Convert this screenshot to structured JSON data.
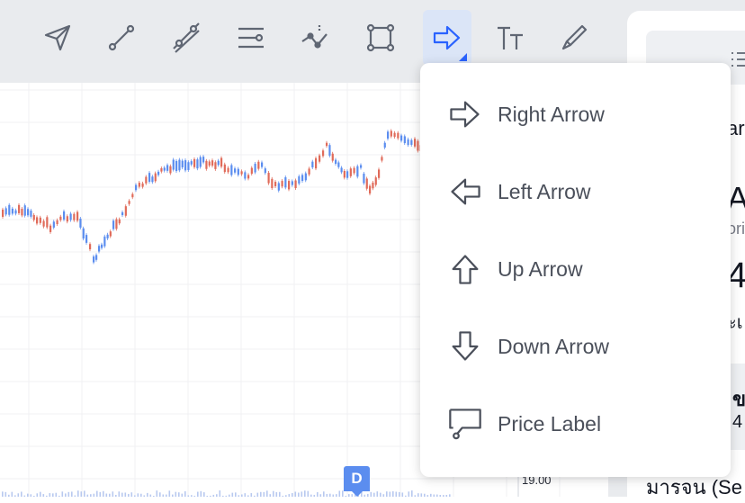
{
  "toolbar": {
    "tools": [
      {
        "id": "cursor-arrow",
        "icon": "arrow-cursor-icon"
      },
      {
        "id": "trend-line",
        "icon": "trend-line-icon"
      },
      {
        "id": "parallel-channel",
        "icon": "parallel-channel-icon"
      },
      {
        "id": "fib-levels",
        "icon": "horizontal-lines-icon"
      },
      {
        "id": "pattern",
        "icon": "pattern-icon"
      },
      {
        "id": "rectangle",
        "icon": "rectangle-icon"
      },
      {
        "id": "arrow-shapes",
        "icon": "right-arrow-icon",
        "active": true
      },
      {
        "id": "text",
        "icon": "text-icon"
      },
      {
        "id": "brush",
        "icon": "brush-icon"
      }
    ],
    "active_color": "#2962ff"
  },
  "menu": {
    "items": [
      {
        "label": "Right Arrow",
        "icon": "right-arrow-icon"
      },
      {
        "label": "Left Arrow",
        "icon": "left-arrow-icon"
      },
      {
        "label": "Up Arrow",
        "icon": "up-arrow-icon"
      },
      {
        "label": "Down Arrow",
        "icon": "down-arrow-icon"
      },
      {
        "label": "Price Label",
        "icon": "price-label-icon"
      }
    ]
  },
  "chart": {
    "price_axis_label": "19.00",
    "marker_label": "D",
    "up_color": "#5b8def",
    "down_color": "#e06b5a"
  },
  "side_panel": {
    "frag_1": "ar",
    "frag_2": "A",
    "frag_3": "ori",
    "frag_4": "4",
    "frag_5": "ะเ",
    "frag_6": "ข",
    "frag_7": "4",
    "frag_8": "มารจน (Se"
  }
}
